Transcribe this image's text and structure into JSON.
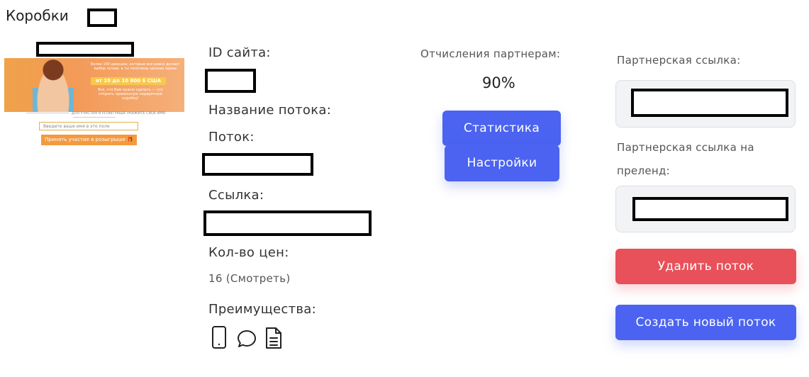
{
  "page": {
    "title": "Коробки"
  },
  "preview": {
    "headline": "Более 100 девушек, которые все равно делают выбор лучше, а ты получишь ценные призы",
    "prize": "от 10 до 10 000 $ США",
    "subline": "Все, что Вам нужно сделать — это открыть правильную подарочную коробку!",
    "divider": "ДЛЯ УЧАСТИЯ В РОЗЫГРЫШЕ УКАЖИТЕ СВОЕ ИМЯ",
    "input_placeholder": "Введите ваше имя в это поле",
    "button_label": "Принять участие в розыгрыше 🎁"
  },
  "info": {
    "site_id_label": "ID сайта:",
    "stream_name_label": "Название потока:",
    "stream_label": "Поток:",
    "link_label": "Ссылка:",
    "prices_label": "Кол-во цен:",
    "prices_value": "16 (Смотреть)",
    "advantages_label": "Преимущества:"
  },
  "advantages_icons": [
    "phone-icon",
    "chat-icon",
    "document-icon"
  ],
  "partner": {
    "commission_label": "Отчисления партнерам:",
    "commission_value": "90%",
    "stats_button": "Статистика",
    "settings_button": "Настройки"
  },
  "links": {
    "partner_link_label": "Партнерская ссылка:",
    "prelend_link_label": "Партнерская ссылка на преленд:",
    "delete_button": "Удалить поток",
    "create_button": "Создать новый поток"
  },
  "colors": {
    "primary": "#4b63f0",
    "danger": "#e8515a"
  }
}
